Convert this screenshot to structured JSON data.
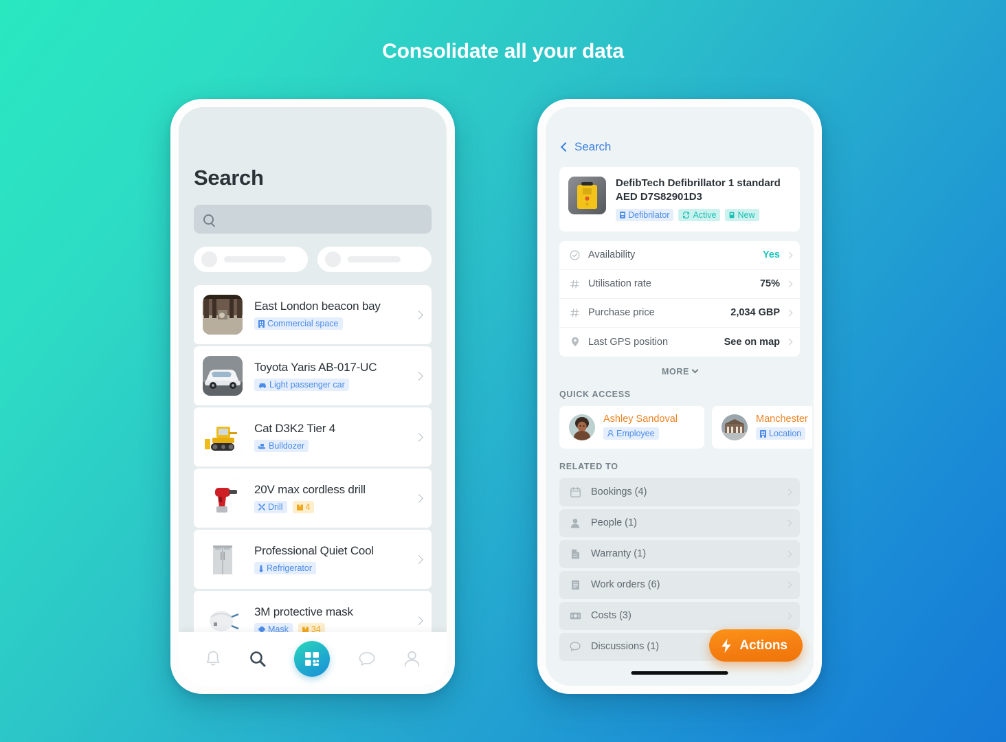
{
  "headline": "Consolidate all your data",
  "colors": {
    "bg_start": "#29e8c0",
    "bg_end": "#1579d6",
    "accent_blue": "#4c8ce8",
    "accent_teal": "#1ec5be",
    "accent_orange": "#ee8322",
    "action_orange": "#f57f12"
  },
  "left_phone": {
    "title": "Search",
    "search": {
      "placeholder": "",
      "value": "",
      "icon": "search-icon"
    },
    "filter_pills": [
      {
        "icon": "skeleton-circle",
        "label": ""
      },
      {
        "icon": "skeleton-circle",
        "label": ""
      }
    ],
    "results": [
      {
        "title": "East London beacon bay",
        "thumb": "warehouse-photo",
        "tags": [
          {
            "label": "Commercial space",
            "icon": "building-icon",
            "style": "blue"
          }
        ]
      },
      {
        "title": "Toyota Yaris AB-017-UC",
        "thumb": "car-photo",
        "tags": [
          {
            "label": "Light passenger car",
            "icon": "car-icon",
            "style": "blue"
          }
        ]
      },
      {
        "title": "Cat D3K2 Tier 4",
        "thumb": "bulldozer-photo",
        "tags": [
          {
            "label": "Bulldozer",
            "icon": "bulldozer-icon",
            "style": "blue"
          }
        ]
      },
      {
        "title": "20V max cordless drill",
        "thumb": "drill-photo",
        "tags": [
          {
            "label": "Drill",
            "icon": "drill-icon",
            "style": "blue"
          },
          {
            "label": "4",
            "icon": "box-icon",
            "style": "orange"
          }
        ]
      },
      {
        "title": "Professional Quiet Cool",
        "thumb": "refrigerator-photo",
        "tags": [
          {
            "label": "Refrigerator",
            "icon": "thermometer-icon",
            "style": "blue"
          }
        ]
      },
      {
        "title": "3M protective mask",
        "thumb": "mask-photo",
        "tags": [
          {
            "label": "Mask",
            "icon": "mask-icon",
            "style": "blue"
          },
          {
            "label": "34",
            "icon": "box-icon",
            "style": "orange"
          }
        ]
      }
    ],
    "tabbar": [
      {
        "name": "notifications",
        "icon": "bell-icon",
        "active": false
      },
      {
        "name": "search",
        "icon": "search-icon",
        "active": true
      },
      {
        "name": "scan",
        "icon": "qr-code-icon",
        "active": false
      },
      {
        "name": "messages",
        "icon": "chat-bubble-icon",
        "active": false
      },
      {
        "name": "profile",
        "icon": "person-icon",
        "active": false
      }
    ]
  },
  "right_phone": {
    "back_label": "Search",
    "asset": {
      "name": "DefibTech Defibrillator 1 standard AED D7S82901D3",
      "thumb": "defibrillator-photo",
      "tags": [
        {
          "label": "Defibrilator",
          "icon": "device-icon",
          "style": "blue"
        },
        {
          "label": "Active",
          "icon": "sync-icon",
          "style": "teal"
        },
        {
          "label": "New",
          "icon": "tag-icon",
          "style": "teal"
        }
      ]
    },
    "details": [
      {
        "label": "Availability",
        "value": "Yes",
        "icon": "check-circle-icon",
        "highlight": true
      },
      {
        "label": "Utilisation rate",
        "value": "75%",
        "icon": "hash-icon",
        "highlight": false
      },
      {
        "label": "Purchase price",
        "value": "2,034 GBP",
        "icon": "hash-icon",
        "highlight": false
      },
      {
        "label": "Last GPS position",
        "value": "See on map",
        "icon": "pin-icon",
        "highlight": false
      }
    ],
    "more_label": "MORE",
    "quick_access_heading": "QUICK ACCESS",
    "quick_access": [
      {
        "name": "Ashley Sandoval",
        "tag": "Employee",
        "tag_icon": "person-icon",
        "avatar": "woman-photo"
      },
      {
        "name": "Manchester",
        "tag": "Location",
        "tag_icon": "building-icon",
        "avatar": "building-photo"
      }
    ],
    "related_heading": "RELATED TO",
    "related": [
      {
        "label": "Bookings (4)",
        "icon": "calendar-icon"
      },
      {
        "label": "People (1)",
        "icon": "person-icon"
      },
      {
        "label": "Warranty (1)",
        "icon": "document-icon"
      },
      {
        "label": "Work orders (6)",
        "icon": "list-icon"
      },
      {
        "label": "Costs (3)",
        "icon": "money-icon"
      },
      {
        "label": "Discussions (1)",
        "icon": "chat-bubble-icon"
      }
    ],
    "actions_button": {
      "label": "Actions",
      "icon": "lightning-icon"
    }
  }
}
